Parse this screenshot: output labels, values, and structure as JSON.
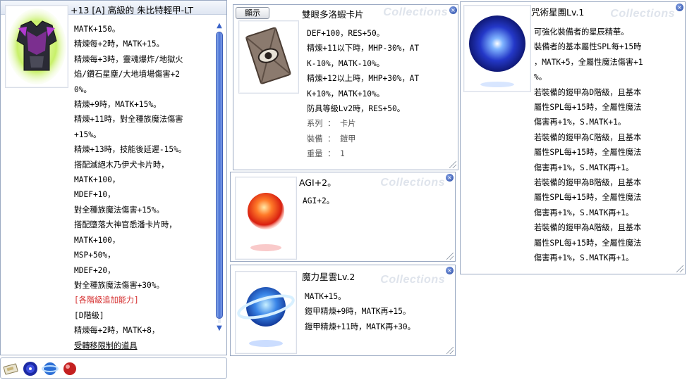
{
  "equipment_window": {
    "title": "+13 [A] 高級的 朱比特輕甲-LT",
    "lines": [
      {
        "text": "MATK+150。",
        "style": ""
      },
      {
        "text": "精煉每+2時，MATK+15。",
        "style": ""
      },
      {
        "text": "精煉每+3時，靈魂爆炸/地獄火",
        "style": ""
      },
      {
        "text": "焰/鑽石星塵/大地墳場傷害+2",
        "style": ""
      },
      {
        "text": "0%。",
        "style": ""
      },
      {
        "text": "精煉+9時，MATK+15%。",
        "style": ""
      },
      {
        "text": "精煉+11時，對全種族魔法傷害",
        "style": ""
      },
      {
        "text": "+15%。",
        "style": ""
      },
      {
        "text": "精煉+13時，技能後延遲-15%。",
        "style": ""
      },
      {
        "text": "搭配滅絕木乃伊犬卡片時，",
        "style": ""
      },
      {
        "text": "MATK+100，",
        "style": ""
      },
      {
        "text": "MDEF+10，",
        "style": ""
      },
      {
        "text": "對全種族魔法傷害+15%。",
        "style": ""
      },
      {
        "text": "搭配墮落大神官悉潘卡片時，",
        "style": ""
      },
      {
        "text": "MATK+100，",
        "style": ""
      },
      {
        "text": "MSP+50%，",
        "style": ""
      },
      {
        "text": "MDEF+20，",
        "style": ""
      },
      {
        "text": "對全種族魔法傷害+30%。",
        "style": ""
      },
      {
        "text": "[各階級追加能力]",
        "style": "red"
      },
      {
        "text": "[D階級]",
        "style": ""
      },
      {
        "text": "精煉每+2時，MATK+8，",
        "style": ""
      },
      {
        "text": "受轉移限制的道具",
        "style": "underline"
      }
    ]
  },
  "card_window": {
    "title": "雙眼多洛蝦卡片",
    "show_button": "顯示",
    "watermark": "Collections",
    "lines": [
      {
        "text": "DEF+100，RES+50。",
        "style": ""
      },
      {
        "text": "精煉+11以下時，MHP-30%，AT",
        "style": ""
      },
      {
        "text": "K-10%，MATK-10%。",
        "style": ""
      },
      {
        "text": "精煉+12以上時，MHP+30%，AT",
        "style": ""
      },
      {
        "text": "K+10%，MATK+10%。",
        "style": ""
      },
      {
        "text": "防具等級Lv2時，RES+50。",
        "style": ""
      },
      {
        "text": "系列 ： 卡片",
        "style": "gray"
      },
      {
        "text": "裝備 ： 鎧甲",
        "style": "gray"
      },
      {
        "text": "重量 ： 1",
        "style": "gray"
      }
    ]
  },
  "agi_window": {
    "title": "AGI+2。",
    "watermark": "Collections",
    "lines": [
      {
        "text": "AGI+2。",
        "style": ""
      }
    ]
  },
  "nebula_window": {
    "title": "魔力星雲Lv.2",
    "watermark": "Collections",
    "lines": [
      {
        "text": "MATK+15。",
        "style": ""
      },
      {
        "text": "鎧甲精煉+9時，MATK再+15。",
        "style": ""
      },
      {
        "text": "鎧甲精煉+11時，MATK再+30。",
        "style": ""
      }
    ]
  },
  "spell_window": {
    "title": "咒術星團Lv.1",
    "watermark": "Collections",
    "lines": [
      {
        "text": "可強化裝備者的星辰精華。",
        "style": ""
      },
      {
        "text": "裝備者的基本屬性SPL每+15時",
        "style": ""
      },
      {
        "text": "，MATK+5，全屬性魔法傷害+1",
        "style": ""
      },
      {
        "text": "%。",
        "style": ""
      },
      {
        "text": "若裝備的鎧甲為D階級，且基本",
        "style": ""
      },
      {
        "text": "屬性SPL每+15時，全屬性魔法",
        "style": ""
      },
      {
        "text": "傷害再+1%，S.MATK+1。",
        "style": ""
      },
      {
        "text": "若裝備的鎧甲為C階級，且基本",
        "style": ""
      },
      {
        "text": "屬性SPL每+15時，全屬性魔法",
        "style": ""
      },
      {
        "text": "傷害再+1%，S.MATK再+1。",
        "style": ""
      },
      {
        "text": "若裝備的鎧甲為B階級，且基本",
        "style": ""
      },
      {
        "text": "屬性SPL每+15時，全屬性魔法",
        "style": ""
      },
      {
        "text": "傷害再+1%，S.MATK再+1。",
        "style": ""
      },
      {
        "text": "若裝備的鎧甲為A階級，且基本",
        "style": ""
      },
      {
        "text": "屬性SPL每+15時，全屬性魔法",
        "style": ""
      },
      {
        "text": "傷害再+1%，S.MATK再+1。",
        "style": ""
      }
    ]
  },
  "tray": {
    "items": [
      "card-item-icon",
      "blue-orb-icon",
      "blue-planet-icon",
      "red-orb-icon"
    ]
  }
}
